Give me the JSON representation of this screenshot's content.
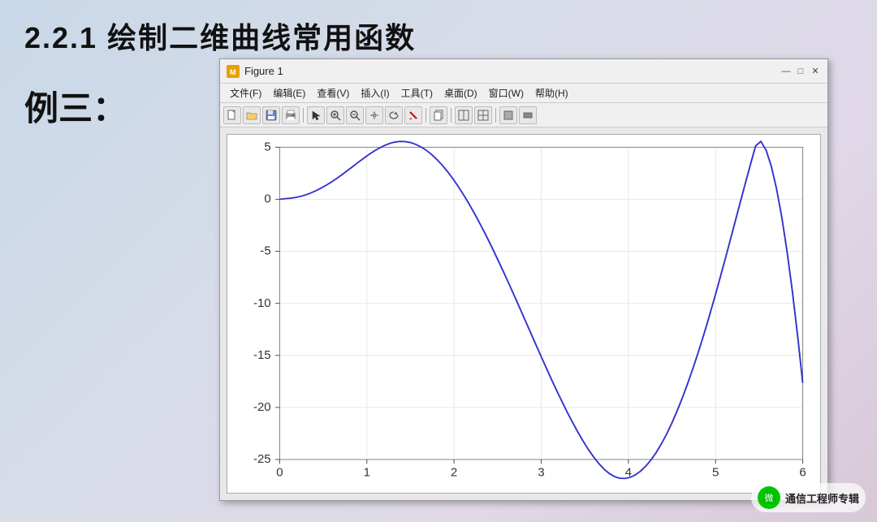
{
  "page": {
    "title": "2.2.1  绘制二维曲线常用函数",
    "example_label": "例三："
  },
  "figure_window": {
    "title": "Figure 1",
    "menus": [
      "文件(F)",
      "编辑(E)",
      "查看(V)",
      "插入(I)",
      "工具(T)",
      "桌面(D)",
      "窗口(W)",
      "帮助(H)"
    ],
    "title_controls": [
      "—",
      "□",
      "×"
    ]
  },
  "chart": {
    "x_min": 0,
    "x_max": 6,
    "y_min": -25,
    "y_max": 5,
    "x_ticks": [
      0,
      1,
      2,
      3,
      4,
      5,
      6
    ],
    "y_ticks": [
      5,
      0,
      -5,
      -10,
      -15,
      -20,
      -25
    ],
    "curve_color": "#3333cc"
  },
  "watermark": {
    "icon_text": "📱",
    "text": "通信工程师专辑"
  }
}
